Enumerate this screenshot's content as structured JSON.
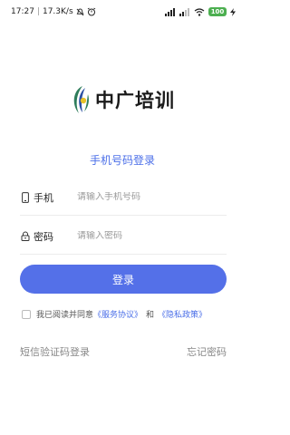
{
  "status_bar": {
    "time": "17:27",
    "network_speed": "17.3K/s",
    "icons_left": [
      "mute-icon",
      "alarm-icon"
    ],
    "signal": "signal-icon",
    "wifi": "wifi-icon",
    "battery": "100",
    "charging": "charging-icon"
  },
  "logo": {
    "text": "中广培训"
  },
  "mode_title": "手机号码登录",
  "phone_field": {
    "label": "手机",
    "placeholder": "请输入手机号码",
    "value": ""
  },
  "password_field": {
    "label": "密码",
    "placeholder": "请输入密码",
    "value": ""
  },
  "login_button": "登录",
  "agreement": {
    "prefix": "我已阅读并同意",
    "service_link": "《服务协议》",
    "conjunction": "和",
    "privacy_link": "《隐私政策》",
    "checked": false
  },
  "sms_login": "短信验证码登录",
  "forgot_password": "忘记密码",
  "colors": {
    "accent": "#5470e8",
    "link": "#4a6ee8"
  }
}
